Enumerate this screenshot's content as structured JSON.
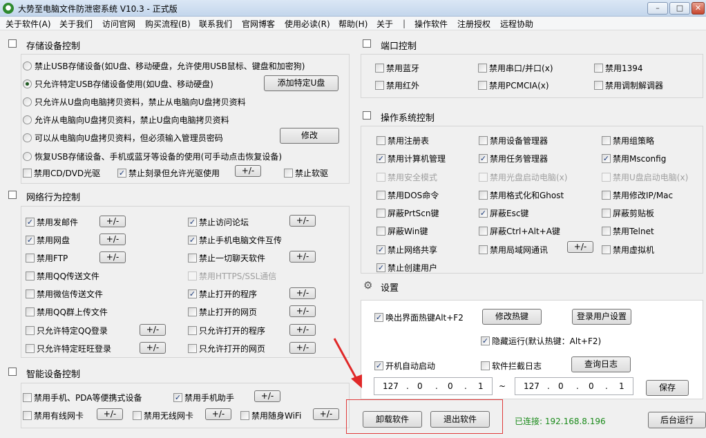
{
  "window": {
    "title": "大势至电脑文件防泄密系统 V10.3 - 正式版",
    "minimize": "–",
    "maximize": "□",
    "close": "✕"
  },
  "menu": {
    "items": [
      "关于软件(A)",
      "关于我们",
      "访问官网",
      "购买流程(B)",
      "联系我们",
      "官网博客",
      "使用必读(R)",
      "帮助(H)",
      "关于",
      "操作软件",
      "注册授权",
      "远程协助"
    ],
    "separator": "|"
  },
  "usb": {
    "title": "存储设备控制",
    "radios": [
      "禁止USB存储设备(如U盘、移动硬盘，允许使用USB鼠标、键盘和加密狗)",
      "只允许特定USB存储设备使用(如U盘、移动硬盘)",
      "只允许从U盘向电脑拷贝资料，禁止从电脑向U盘拷贝资料",
      "允许从电脑向U盘拷贝资料，禁止U盘向电脑拷贝资料",
      "可以从电脑向U盘拷贝资料，但必须输入管理员密码",
      "恢复USB存储设备、手机或蓝牙等设备的使用(可手动点击恢复设备)"
    ],
    "selected_index": 1,
    "add_button": "添加特定U盘",
    "modify_button": "修改",
    "cb_cdrom": "禁用CD/DVD光驱",
    "cb_burn": "禁止刻录但允许光驱使用",
    "cb_floppy": "禁止软驱",
    "plusminus": "+/-"
  },
  "network": {
    "title": "网络行为控制",
    "left": [
      {
        "label": "禁用发邮件",
        "checked": true
      },
      {
        "label": "禁用网盘",
        "checked": true
      },
      {
        "label": "禁用FTP",
        "checked": false
      },
      {
        "label": "禁用QQ传送文件",
        "checked": false
      },
      {
        "label": "禁用微信传送文件",
        "checked": false
      },
      {
        "label": "禁用QQ群上传文件",
        "checked": false
      },
      {
        "label": "只允许特定QQ登录",
        "checked": false
      },
      {
        "label": "只允许特定旺旺登录",
        "checked": false
      }
    ],
    "right": [
      {
        "label": "禁止访问论坛",
        "checked": true
      },
      {
        "label": "禁止手机电脑文件互传",
        "checked": true
      },
      {
        "label": "禁止一切聊天软件",
        "checked": false
      },
      {
        "label": "禁用HTTPS/SSL通信",
        "checked": false,
        "disabled": true
      },
      {
        "label": "禁止打开的程序",
        "checked": true
      },
      {
        "label": "禁止打开的网页",
        "checked": false
      },
      {
        "label": "只允许打开的程序",
        "checked": false
      },
      {
        "label": "只允许打开的网页",
        "checked": false
      }
    ]
  },
  "smart": {
    "title": "智能设备控制",
    "phone_pda": "禁用手机、PDA等便携式设备",
    "phone_helper": "禁用手机助手",
    "wired_nic": "禁用有线网卡",
    "wireless_nic": "禁用无线网卡",
    "portable_wifi": "禁用随身WiFi"
  },
  "ports": {
    "title": "端口控制",
    "items": [
      {
        "label": "禁用蓝牙",
        "checked": false
      },
      {
        "label": "禁用串口/并口(x)",
        "checked": false
      },
      {
        "label": "禁用1394",
        "checked": false
      },
      {
        "label": "禁用红外",
        "checked": false
      },
      {
        "label": "禁用PCMCIA(x)",
        "checked": false
      },
      {
        "label": "禁用调制解调器",
        "checked": false
      }
    ]
  },
  "os": {
    "title": "操作系统控制",
    "items": [
      {
        "label": "禁用注册表",
        "checked": false
      },
      {
        "label": "禁用设备管理器",
        "checked": false
      },
      {
        "label": "禁用组策略",
        "checked": false
      },
      {
        "label": "禁用计算机管理",
        "checked": true
      },
      {
        "label": "禁用任务管理器",
        "checked": true
      },
      {
        "label": "禁用Msconfig",
        "checked": true
      },
      {
        "label": "禁用安全模式",
        "checked": false,
        "disabled": true
      },
      {
        "label": "禁用光盘启动电脑(x)",
        "checked": false,
        "disabled": true
      },
      {
        "label": "禁用U盘启动电脑(x)",
        "checked": false,
        "disabled": true
      },
      {
        "label": "禁用DOS命令",
        "checked": false
      },
      {
        "label": "禁用格式化和Ghost",
        "checked": false
      },
      {
        "label": "禁用修改IP/Mac",
        "checked": false
      },
      {
        "label": "屏蔽PrtScn键",
        "checked": false
      },
      {
        "label": "屏蔽Esc键",
        "checked": true
      },
      {
        "label": "屏蔽剪贴板",
        "checked": false
      },
      {
        "label": "屏蔽Win键",
        "checked": false
      },
      {
        "label": "屏蔽Ctrl+Alt+A键",
        "checked": false
      },
      {
        "label": "禁用Telnet",
        "checked": false
      },
      {
        "label": "禁止网络共享",
        "checked": true
      },
      {
        "label": "禁用局域网通讯",
        "checked": false
      },
      {
        "label": "禁用虚拟机",
        "checked": false
      },
      {
        "label": "禁止创建用户",
        "checked": true
      }
    ]
  },
  "settings": {
    "title": "设置",
    "hotkey_cb": "唤出界面热键Alt+F2",
    "hotkey_btn": "修改热键",
    "login_btn": "登录用户设置",
    "hidden_run": "隐藏运行(默认热键：Alt+F2)",
    "autostart": "开机自动启动",
    "intercept_log": "软件拦截日志",
    "query_log": "查询日志",
    "ip_start": [
      "127",
      "0",
      "0",
      "1"
    ],
    "ip_end": [
      "127",
      "0",
      "0",
      "1"
    ],
    "ip_dot": ".",
    "range_sep": "~",
    "save": "保存"
  },
  "footer": {
    "uninstall": "卸载软件",
    "exit": "退出软件",
    "status": "已连接: 192.168.8.196",
    "background": "后台运行"
  }
}
